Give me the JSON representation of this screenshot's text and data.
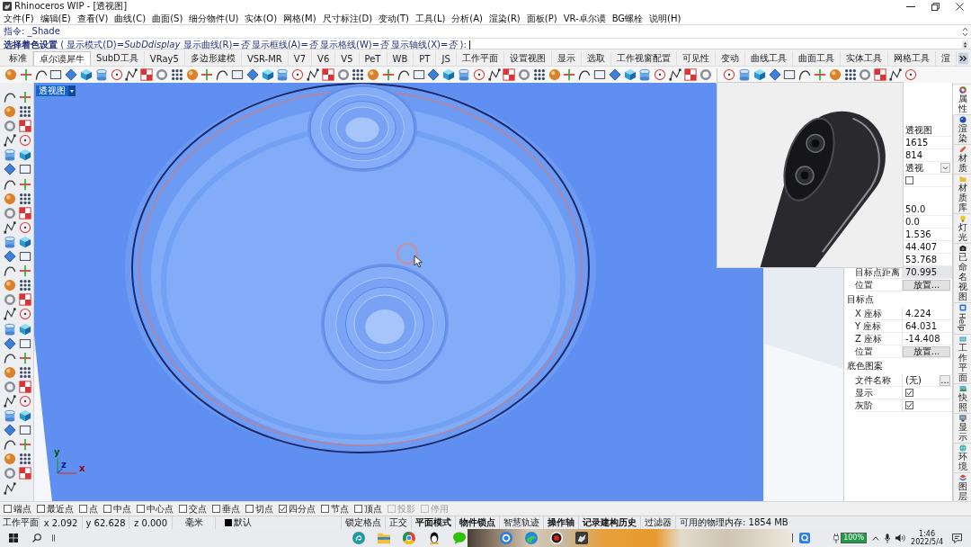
{
  "window": {
    "title": "Rhinoceros WIP - [透视图]"
  },
  "menu": [
    "文件(F)",
    "编辑(E)",
    "查看(V)",
    "曲线(C)",
    "曲面(S)",
    "细分物件(U)",
    "实体(O)",
    "网格(M)",
    "尺寸标注(D)",
    "变动(T)",
    "工具(L)",
    "分析(A)",
    "渲染(R)",
    "面板(P)",
    "VR-卓尔谟",
    "BG螺栓",
    "说明(H)"
  ],
  "command": {
    "history": "指令: _Shade",
    "prompt": "**选择着色设置** ( 显示模式(D)=*SubDdisplay* 显示曲线(R)=*否* 显示框线(A)=*否* 显示格线(W)=*否* 显示轴线(X)=*否* ):"
  },
  "tabs": [
    {
      "label": "标准",
      "selected": false
    },
    {
      "label": "卓尔谟犀牛",
      "selected": true
    },
    {
      "label": "SubD工具",
      "selected": false
    },
    {
      "label": "VRay5",
      "selected": false
    },
    {
      "label": "多边形建模",
      "selected": false
    },
    {
      "label": "VSR-MR",
      "selected": false
    },
    {
      "label": "V7",
      "selected": false
    },
    {
      "label": "V6",
      "selected": false
    },
    {
      "label": "V5",
      "selected": false
    },
    {
      "label": "PeT",
      "selected": false
    },
    {
      "label": "WB",
      "selected": false
    },
    {
      "label": "PT",
      "selected": false
    },
    {
      "label": "JS",
      "selected": false
    },
    {
      "label": "工作平面",
      "selected": false
    },
    {
      "label": "设置视图",
      "selected": false
    },
    {
      "label": "显示",
      "selected": false
    },
    {
      "label": "选取",
      "selected": false
    },
    {
      "label": "工作视窗配置",
      "selected": false
    },
    {
      "label": "可见性",
      "selected": false
    },
    {
      "label": "变动",
      "selected": false
    },
    {
      "label": "曲线工具",
      "selected": false
    },
    {
      "label": "曲面工具",
      "selected": false
    },
    {
      "label": "实体工具",
      "selected": false
    },
    {
      "label": "网格工具",
      "selected": false
    },
    {
      "label": "渲",
      "selected": false
    }
  ],
  "viewport": {
    "label": "透视图",
    "axes": [
      "y",
      "z",
      "x"
    ]
  },
  "properties": {
    "groups": [
      {
        "rows": [
          {
            "kind": "text",
            "value": "透视图"
          },
          {
            "kind": "text",
            "value": "1615"
          },
          {
            "kind": "text",
            "value": "814"
          },
          {
            "kind": "dropdown",
            "value": "透视"
          },
          {
            "kind": "checkbox",
            "checked": false
          }
        ]
      },
      {
        "rows": [
          {
            "kind": "text",
            "value": "50.0"
          },
          {
            "kind": "text",
            "value": "0.0"
          },
          {
            "kind": "text",
            "value": "1.536"
          },
          {
            "kind": "text",
            "value": "44.407"
          },
          {
            "kind": "text",
            "value": "53.768"
          },
          {
            "kind": "readonly",
            "label": "目标点距离",
            "value": "70.995"
          },
          {
            "kind": "button",
            "label": "位置",
            "value": "放置..."
          }
        ]
      },
      {
        "title": "目标点",
        "rows": [
          {
            "kind": "text",
            "label": "X 座标",
            "value": "4.224"
          },
          {
            "kind": "text",
            "label": "Y 座标",
            "value": "64.031"
          },
          {
            "kind": "text",
            "label": "Z 座标",
            "value": "-14.408"
          },
          {
            "kind": "button",
            "label": "位置",
            "value": "放置..."
          }
        ]
      },
      {
        "title": "底色图案",
        "rows": [
          {
            "kind": "file",
            "label": "文件名称",
            "value": "(无)",
            "button": "..."
          },
          {
            "kind": "checkbox",
            "label": "显示",
            "checked": true
          },
          {
            "kind": "checkbox",
            "label": "灰阶",
            "checked": true
          }
        ]
      }
    ]
  },
  "side_tabs": [
    {
      "label": "属性",
      "kind": "stacked",
      "selected": true
    },
    {
      "label": "渲染",
      "kind": "stacked",
      "selected": false
    },
    {
      "label": "材质",
      "kind": "stacked",
      "selected": false
    },
    {
      "label": "材质库",
      "kind": "stacked",
      "selected": false
    },
    {
      "label": "灯光",
      "kind": "stacked",
      "selected": false
    },
    {
      "label": "已命名视图",
      "kind": "stacked",
      "selected": false
    },
    {
      "label": "Help",
      "kind": "rotated",
      "selected": false
    },
    {
      "label": "工作平面",
      "kind": "stacked",
      "selected": false
    },
    {
      "label": "快照",
      "kind": "stacked",
      "selected": false
    },
    {
      "label": "显示",
      "kind": "stacked",
      "selected": false
    },
    {
      "label": "环境",
      "kind": "stacked",
      "selected": false
    },
    {
      "label": "图层",
      "kind": "stacked",
      "selected": false
    }
  ],
  "osnaps": [
    {
      "label": "端点",
      "checked": false,
      "disabled": false
    },
    {
      "label": "最近点",
      "checked": false,
      "disabled": false
    },
    {
      "label": "点",
      "checked": false,
      "disabled": false
    },
    {
      "label": "中点",
      "checked": false,
      "disabled": false
    },
    {
      "label": "中心点",
      "checked": false,
      "disabled": false
    },
    {
      "label": "交点",
      "checked": false,
      "disabled": false
    },
    {
      "label": "垂点",
      "checked": false,
      "disabled": false
    },
    {
      "label": "切点",
      "checked": false,
      "disabled": false
    },
    {
      "label": "四分点",
      "checked": true,
      "disabled": false
    },
    {
      "label": "节点",
      "checked": false,
      "disabled": false
    },
    {
      "label": "顶点",
      "checked": false,
      "disabled": false
    },
    {
      "label": "投影",
      "checked": false,
      "disabled": true
    },
    {
      "label": "停用",
      "checked": false,
      "disabled": true
    }
  ],
  "status_bar": {
    "cplane": "工作平面",
    "x": "x 2.092",
    "y": "y 62.628",
    "z": "z 0.000",
    "units": "毫米",
    "layer": "默认",
    "toggles": [
      {
        "label": "锁定格点",
        "on": false
      },
      {
        "label": "正交",
        "on": false
      },
      {
        "label": "平面模式",
        "on": true
      },
      {
        "label": "物件锁点",
        "on": true
      },
      {
        "label": "智慧轨迹",
        "on": false
      },
      {
        "label": "操作轴",
        "on": true
      },
      {
        "label": "记录建构历史",
        "on": true
      },
      {
        "label": "过滤器",
        "on": false
      }
    ],
    "memory": "可用的物理内存: 1854 MB"
  },
  "taskbar": {
    "battery": "100%",
    "time": "1:46",
    "date": "2022/5/4"
  }
}
